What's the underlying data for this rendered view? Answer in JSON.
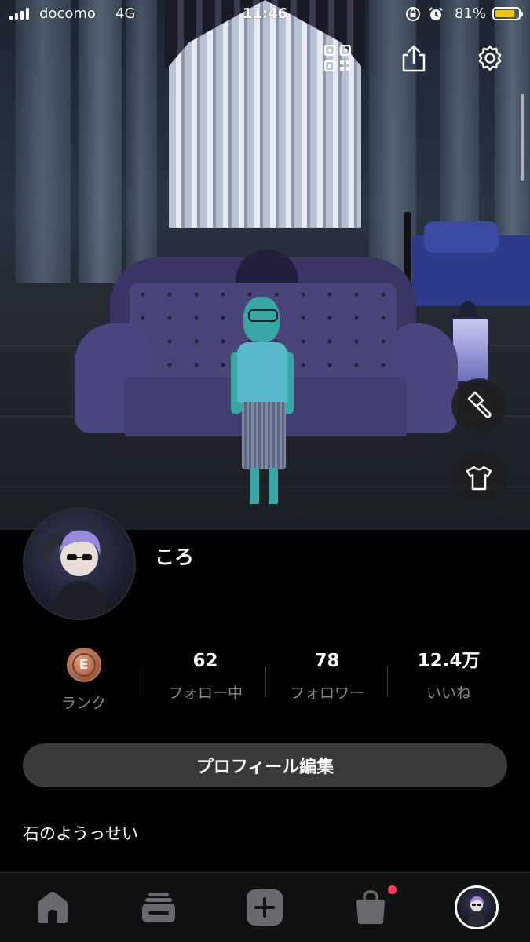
{
  "status_bar": {
    "carrier": "docomo",
    "network": "4G",
    "time": "11:46",
    "battery_percent": "81%",
    "battery_level": 0.81,
    "icons": [
      "signal-icon",
      "orientation-lock-icon",
      "alarm-icon",
      "battery-icon"
    ]
  },
  "header": {
    "icons": [
      "qr-code-icon",
      "share-icon",
      "gear-icon"
    ]
  },
  "room_actions": {
    "icons": [
      "brush-icon",
      "t-shirt-icon"
    ]
  },
  "profile": {
    "username": "ころ",
    "bio": "石のようっせい",
    "edit_button_label": "プロフィール編集"
  },
  "stats": {
    "rank": {
      "badge": "E",
      "label": "ランク"
    },
    "following": {
      "value": "62",
      "label": "フォロー中"
    },
    "followers": {
      "value": "78",
      "label": "フォロワー"
    },
    "likes": {
      "value": "12.4万",
      "label": "いいね"
    }
  },
  "tab_bar": {
    "tabs": [
      "home-icon",
      "feed-icon",
      "create-icon",
      "shop-bag-icon",
      "profile-avatar"
    ],
    "notification_color": "#ff3b5c"
  },
  "colors": {
    "background": "#000000",
    "button": "#3a3a3c",
    "battery": "#f5c400",
    "rank_bronze": "#b8755a"
  }
}
